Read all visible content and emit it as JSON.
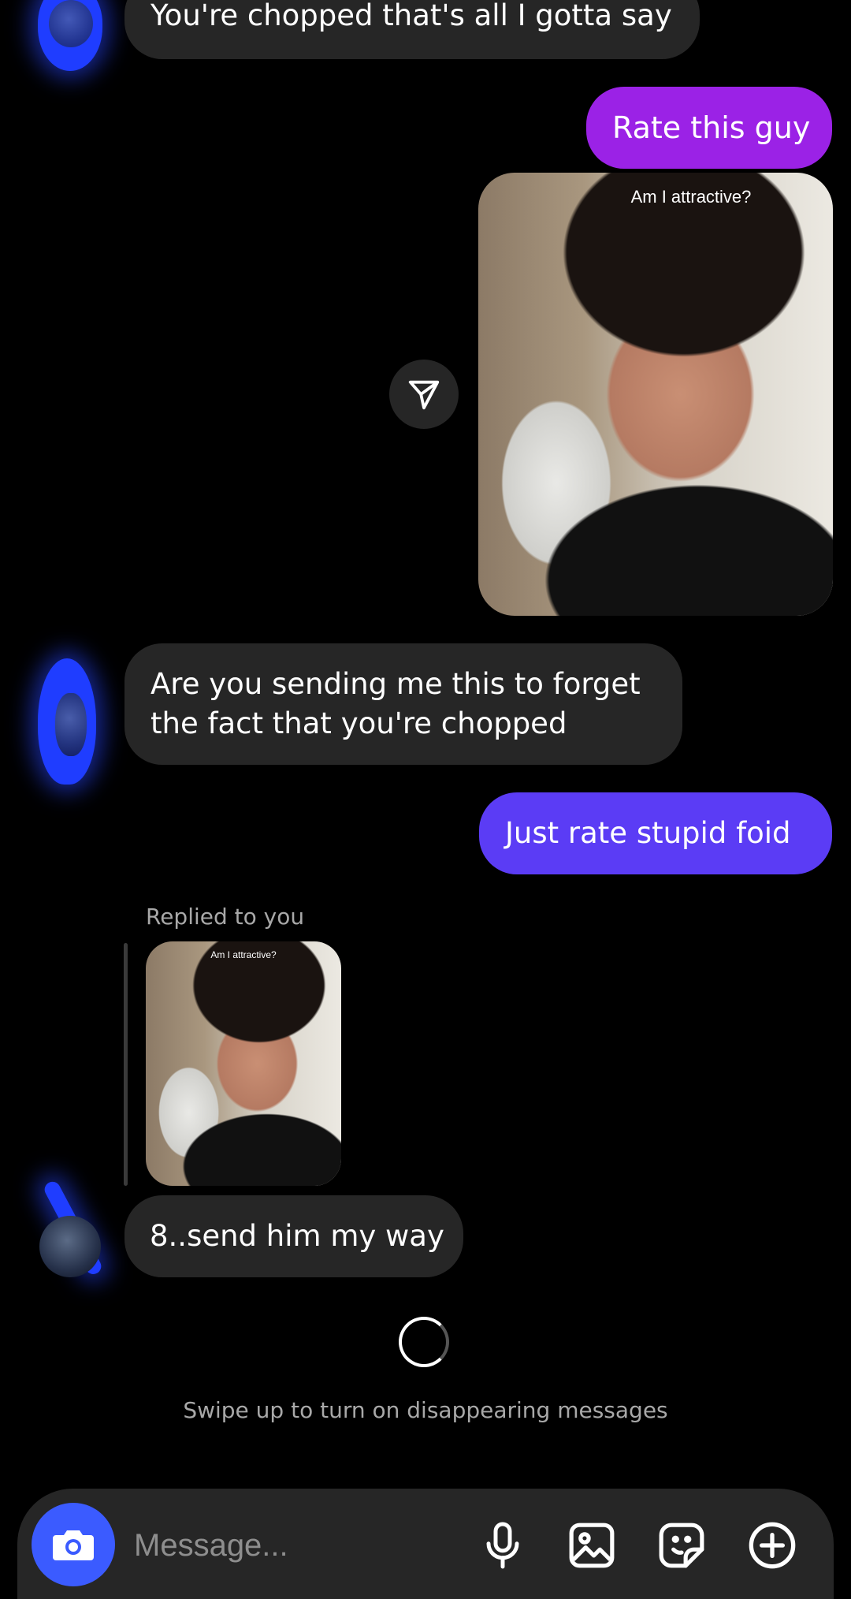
{
  "messages": {
    "m1_text": "You're chopped that's all I gotta say",
    "m2_text": "Rate this guy",
    "m3_caption": "Am I attractive?",
    "m4_text": "Are you sending me this to forget the fact that you're chopped",
    "m5_text": "Just rate stupid foid",
    "reply_label": "Replied to you",
    "reply_caption": "Am I attractive?",
    "m6_text": "8..send him my way"
  },
  "footer": {
    "hint": "Swipe up to turn on disappearing messages"
  },
  "composer": {
    "placeholder": "Message..."
  },
  "icons": {
    "camera": "camera-icon",
    "share": "send-icon",
    "mic": "microphone-icon",
    "gallery": "gallery-icon",
    "sticker": "sticker-icon",
    "add": "plus-circle-icon"
  },
  "colors": {
    "background": "#000000",
    "incoming_bubble": "#262626",
    "outgoing_bubble_1": "#9b22e6",
    "outgoing_bubble_2": "#5b3cf5",
    "camera_button": "#3b5bff",
    "avatar_scribble": "#1f3dff"
  }
}
